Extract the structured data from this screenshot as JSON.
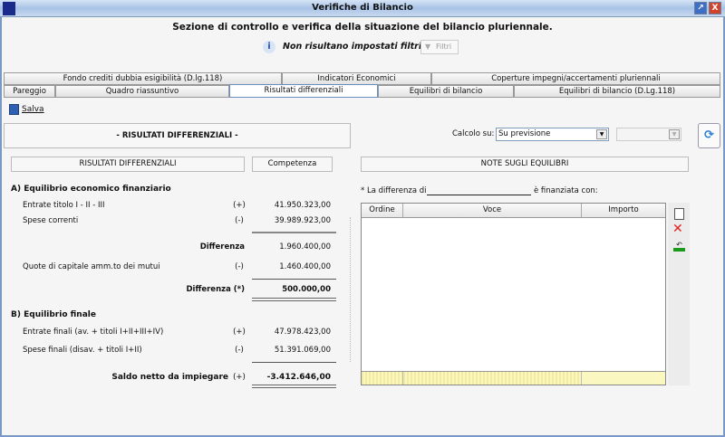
{
  "window": {
    "title": "Verifiche di Bilancio"
  },
  "header": {
    "title": "Sezione di controllo e verifica della situazione del bilancio pluriennale.",
    "filter_status": "Non risultano impostati filtri",
    "filter_button": "Filtri"
  },
  "tabs_row1": [
    "Fondo crediti dubbia esigibilità (D.lg.118)",
    "Indicatori Economici",
    "Coperture impegni/accertamenti pluriennali"
  ],
  "tabs_row2": [
    "Pareggio",
    "Quadro riassuntivo",
    "Risultati differenziali",
    "Equilibri di bilancio",
    "Equilibri di bilancio (D.Lg.118)"
  ],
  "toolbar": {
    "save": "Salva"
  },
  "panel": {
    "title": "- RISULTATI DIFFERENZIALI -",
    "calcolo_label": "Calcolo su:",
    "calcolo_value": "Su previsione",
    "secondary_value": ""
  },
  "left": {
    "col_header": "RISULTATI DIFFERENZIALI",
    "col_value": "Competenza",
    "section_a": "A) Equilibrio economico finanziario",
    "rows_a": [
      {
        "label": "Entrate titolo I - II - III",
        "sign": "(+)",
        "value": "41.950.323,00"
      },
      {
        "label": "Spese correnti",
        "sign": "(-)",
        "value": "39.989.923,00"
      },
      {
        "label": "Differenza",
        "sign": "",
        "value": "1.960.400,00"
      },
      {
        "label": "Quote di capitale amm.to dei mutui",
        "sign": "(-)",
        "value": "1.460.400,00"
      },
      {
        "label": "Differenza (*)",
        "sign": "",
        "value": "500.000,00"
      }
    ],
    "section_b": "B) Equilibrio finale",
    "rows_b": [
      {
        "label": "Entrate finali (av. + titoli I+II+III+IV)",
        "sign": "(+)",
        "value": "47.978.423,00"
      },
      {
        "label": "Spese finali (disav. + titoli I+II)",
        "sign": "(-)",
        "value": "51.391.069,00"
      },
      {
        "label": "Saldo netto da impiegare",
        "sign": "(+)",
        "value": "-3.412.646,00"
      }
    ]
  },
  "right": {
    "header": "NOTE SUGLI EQUILIBRI",
    "note_prefix": "* La differenza di",
    "note_suffix": "è finanziata con:",
    "table": {
      "columns": [
        "Ordine",
        "Voce",
        "Importo"
      ],
      "rows": []
    }
  }
}
